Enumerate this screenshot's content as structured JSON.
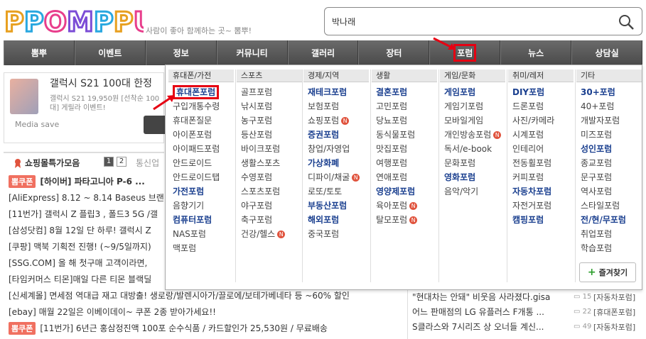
{
  "logo": {
    "text": "PPOMPPU"
  },
  "tagline": "사람이 좋아 함께하는 곳~ 뽐뿌!",
  "search": {
    "value": "박나래"
  },
  "nav": [
    "뽐뿌",
    "이벤트",
    "정보",
    "커뮤니티",
    "갤러리",
    "장터",
    "포럼",
    "뉴스",
    "상담실"
  ],
  "nav_active": "포럼",
  "ad": {
    "title": "갤럭시 S21 100대 한정",
    "desc": "갤럭시 S21 19,950원 [선착순 100대] 게릴라 이벤트!",
    "save": "Media save"
  },
  "shop": {
    "title": "쇼핑몰특가모음",
    "pages": [
      "1",
      "2"
    ],
    "next": "통신업"
  },
  "deals": [
    {
      "badge": "뽐쿠폰",
      "text": "[하이버] 파타고니아 P-6 ...",
      "bold": true
    },
    {
      "badge": "",
      "text": "[AliExpress] 8.12 ~ 8.14 Baseus 브랜",
      "bold": false
    },
    {
      "badge": "",
      "text": "[11번가] 갤럭시 Z 플립3 , 폴드3 5G /갤",
      "bold": false
    },
    {
      "badge": "",
      "text": "[삼성닷컴] 8월 12일 단 하루! 갤럭시 Z",
      "bold": false
    },
    {
      "badge": "",
      "text": "[쿠팡] 맥북 기획전 진행! (~9/5일까지)",
      "bold": false
    },
    {
      "badge": "",
      "text": "[SSG.COM] 올 해 첫구매 고객이라면,",
      "bold": false
    },
    {
      "badge": "",
      "text": "[타임커머스 티몬]매일 다른 티몬 블랙딜",
      "bold": false
    },
    {
      "badge": "",
      "text": "[신세계몰] 면세점 역대급 재고 대방출! 생로랑/발렌시아가/끌로에/보테가베네타 등 ~60% 할인",
      "bold": false
    },
    {
      "badge": "",
      "text": "[ebay] 매월 22일은 이베이데이~ 쿠폰 2종 받아가세요!!",
      "bold": false
    },
    {
      "badge": "뽐쿠폰",
      "text": "[11번가] 6년근 홍삼정진액 100포 순수식품 / 카드할인가 25,530원 / 무료배송",
      "bold": false
    }
  ],
  "right_list": [
    {
      "title": "\"현대차는 안돼\" 비웃음 사라졌다.gisa",
      "count": "15",
      "cat": "[자동차포럼]"
    },
    {
      "title": "어느 판매점의 LG 유플러스 F개통 ...",
      "count": "22",
      "cat": "[휴대폰포럼]"
    },
    {
      "title": "S클라스와 7시리즈 상 오너들 계신...",
      "count": "49",
      "cat": "[자동차포럼]"
    }
  ],
  "mega": {
    "columns": [
      {
        "head": "휴대폰/가전",
        "items": [
          {
            "t": "휴대폰포럼",
            "b": true,
            "hl": true
          },
          {
            "t": "구입개통수령"
          },
          {
            "t": "휴대폰질문"
          },
          {
            "t": "아이폰포럼"
          },
          {
            "t": "아이패드포럼"
          },
          {
            "t": "안드로이드"
          },
          {
            "t": "안드로이드탭"
          },
          {
            "t": "가전포럼",
            "b": true
          },
          {
            "t": "음향기기"
          },
          {
            "t": "컴퓨터포럼",
            "b": true
          },
          {
            "t": "NAS포럼"
          },
          {
            "t": "맥포럼"
          }
        ]
      },
      {
        "head": "스포츠",
        "items": [
          {
            "t": "골프포럼"
          },
          {
            "t": "낚시포럼"
          },
          {
            "t": "농구포럼"
          },
          {
            "t": "등산포럼"
          },
          {
            "t": "바이크포럼"
          },
          {
            "t": "생활스포츠"
          },
          {
            "t": "수영포럼"
          },
          {
            "t": "스포츠포럼"
          },
          {
            "t": "야구포럼"
          },
          {
            "t": "축구포럼"
          },
          {
            "t": "건강/헬스",
            "n": true
          }
        ]
      },
      {
        "head": "경제/지역",
        "items": [
          {
            "t": "재테크포럼",
            "b": true
          },
          {
            "t": "보험포럼"
          },
          {
            "t": "쇼핑포럼",
            "n": true
          },
          {
            "t": "증권포럼",
            "b": true
          },
          {
            "t": "창업/자영업"
          },
          {
            "t": "가상화폐",
            "b": true
          },
          {
            "t": "디파이/채굴",
            "n": true
          },
          {
            "t": "로또/토토"
          },
          {
            "t": "부동산포럼",
            "b": true
          },
          {
            "t": "해외포럼",
            "b": true
          },
          {
            "t": "중국포럼"
          }
        ]
      },
      {
        "head": "생활",
        "items": [
          {
            "t": "결혼포럼",
            "b": true
          },
          {
            "t": "고민포럼"
          },
          {
            "t": "당뇨포럼"
          },
          {
            "t": "동식물포럼"
          },
          {
            "t": "맛집포럼"
          },
          {
            "t": "여행포럼"
          },
          {
            "t": "연애포럼"
          },
          {
            "t": "영양제포럼",
            "b": true
          },
          {
            "t": "육아포럼",
            "n": true
          },
          {
            "t": "탈모포럼",
            "n": true
          }
        ]
      },
      {
        "head": "게임/문화",
        "items": [
          {
            "t": "게임포럼",
            "b": true
          },
          {
            "t": "게임기포럼"
          },
          {
            "t": "모바일게임"
          },
          {
            "t": "개인방송포럼",
            "n": true
          },
          {
            "t": "독서/e-book"
          },
          {
            "t": "문화포럼"
          },
          {
            "t": "영화포럼",
            "b": true
          },
          {
            "t": "음악/악기"
          }
        ]
      },
      {
        "head": "취미/레저",
        "items": [
          {
            "t": "DIY포럼",
            "b": true
          },
          {
            "t": "드론포럼"
          },
          {
            "t": "사진/카메라"
          },
          {
            "t": "시계포럼"
          },
          {
            "t": "인테리어"
          },
          {
            "t": "전동휠포럼"
          },
          {
            "t": "커피포럼"
          },
          {
            "t": "자동차포럼",
            "b": true
          },
          {
            "t": "자전거포럼"
          },
          {
            "t": "캠핑포럼",
            "b": true
          }
        ]
      },
      {
        "head": "기타",
        "items": [
          {
            "t": "30+포럼",
            "b": true
          },
          {
            "t": "40+포럼"
          },
          {
            "t": "개발자포럼"
          },
          {
            "t": "미즈포럼"
          },
          {
            "t": "성인포럼",
            "b": true
          },
          {
            "t": "종교포럼"
          },
          {
            "t": "문구포럼"
          },
          {
            "t": "역사포럼"
          },
          {
            "t": "스타일포럼"
          },
          {
            "t": "전/현/무포럼",
            "b": true
          },
          {
            "t": "취업포럼"
          },
          {
            "t": "학습포럼"
          }
        ]
      }
    ],
    "fav_label": "즐겨찾기",
    "new_badge": "N"
  },
  "colors": {
    "accent_red": "#e60012",
    "link_blue": "#1a3f8f",
    "badge": "#f07060"
  }
}
